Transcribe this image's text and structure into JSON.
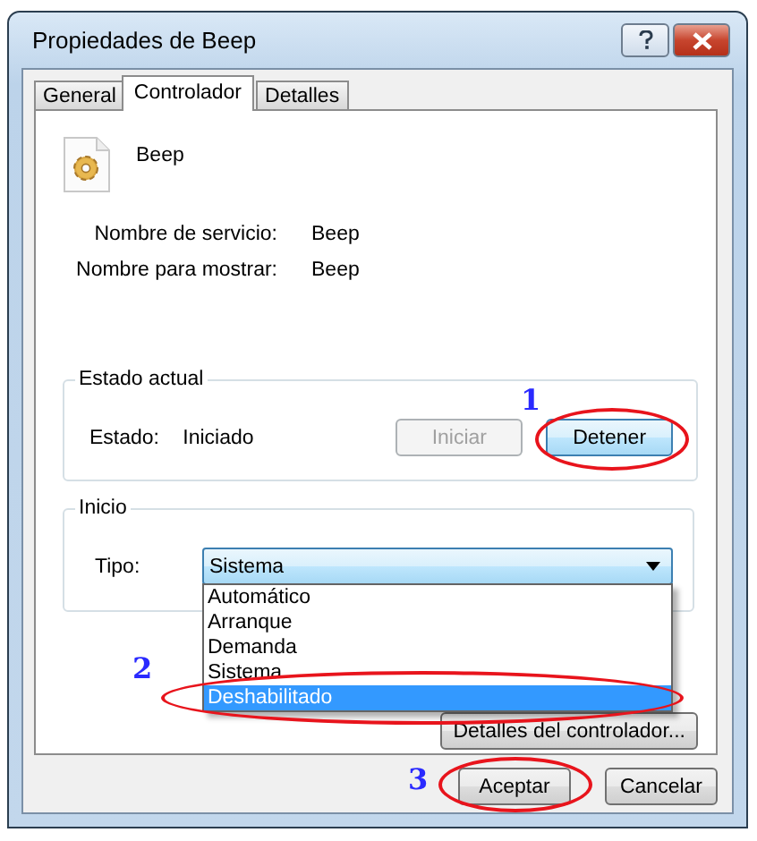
{
  "window": {
    "title": "Propiedades de Beep"
  },
  "tabs": [
    {
      "label": "General",
      "selected": false
    },
    {
      "label": "Controlador",
      "selected": true
    },
    {
      "label": "Detalles",
      "selected": false
    }
  ],
  "driver": {
    "name": "Beep",
    "fields": [
      {
        "label": "Nombre de servicio:",
        "value": "Beep"
      },
      {
        "label": "Nombre para mostrar:",
        "value": "Beep"
      }
    ]
  },
  "status_group": {
    "title": "Estado actual",
    "label": "Estado:",
    "value": "Iniciado",
    "buttons": [
      {
        "label": "Iniciar",
        "disabled": true,
        "highlighted": false
      },
      {
        "label": "Detener",
        "disabled": false,
        "highlighted": true
      }
    ]
  },
  "startup_group": {
    "title": "Inicio",
    "label": "Tipo:",
    "combo": {
      "value": "Sistema",
      "expanded": true,
      "options": [
        {
          "label": "Automático",
          "highlighted": false
        },
        {
          "label": "Arranque",
          "highlighted": false
        },
        {
          "label": "Demanda",
          "highlighted": false
        },
        {
          "label": "Sistema",
          "highlighted": false
        },
        {
          "label": "Deshabilitado",
          "highlighted": true
        }
      ]
    }
  },
  "details_button": "Detalles del controlador...",
  "buttons": [
    {
      "label": "Aceptar"
    },
    {
      "label": "Cancelar"
    }
  ],
  "annotations": [
    {
      "number": "1"
    },
    {
      "number": "2"
    },
    {
      "number": "3"
    }
  ]
}
